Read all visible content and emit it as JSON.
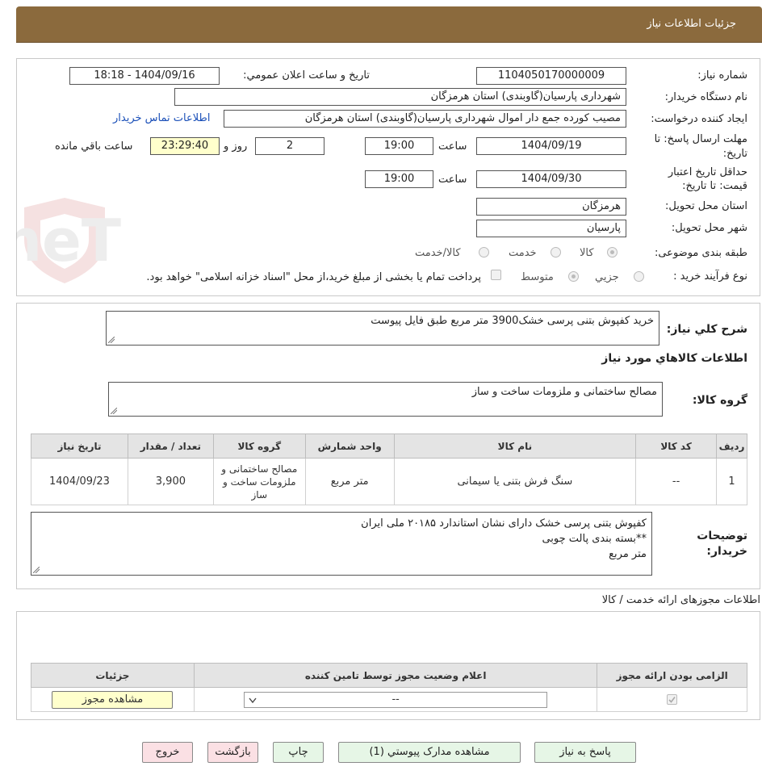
{
  "header": {
    "title": "جزئیات اطلاعات نیاز"
  },
  "form": {
    "need_number_label": "شماره نیاز:",
    "need_number": "1104050170000009",
    "announce_label": "تاریخ و ساعت اعلان عمومي:",
    "announce_value": "1404/09/16 - 18:18",
    "buyer_org_label": "نام دستگاه خریدار:",
    "buyer_org": "شهرداری پارسیان(گاوبندی) استان هرمزگان",
    "requester_label": "ایجاد کننده درخواست:",
    "requester": "مصیب کورده جمع دار اموال شهرداری پارسیان(گاوبندی) استان هرمزگان",
    "contact_link": "اطلاعات تماس خریدار",
    "deadline_label_1": "مهلت ارسال پاسخ: تا",
    "deadline_label_2": "تاریخ:",
    "deadline_date": "1404/09/19",
    "time_label": "ساعت",
    "deadline_time": "19:00",
    "days_value": "2",
    "days_label": "روز و",
    "remaining_time": "23:29:40",
    "remaining_label": "ساعت باقي مانده",
    "validity_label_1": "حداقل تاریخ اعتبار",
    "validity_label_2": "قیمت: تا تاریخ:",
    "validity_date": "1404/09/30",
    "validity_time": "19:00",
    "province_label": "استان محل تحویل:",
    "province": "هرمزگان",
    "city_label": "شهر محل تحویل:",
    "city": "پارسیان",
    "category_label": "طبقه بندی موضوعی:",
    "category_options": [
      "کالا",
      "خدمت",
      "کالا/خدمت"
    ],
    "process_label": "نوع فرآیند خرید :",
    "process_options": [
      "جزیي",
      "متوسط"
    ],
    "payment_note": "پرداخت تمام یا بخشی از مبلغ خرید،از محل \"اسناد خزانه اسلامی\" خواهد بود."
  },
  "summary": {
    "label": "شرح کلي نیاز:",
    "value": "خرید کفپوش بتنی پرسی خشک3900 متر مربع طبق فایل پیوست",
    "goods_info_title": "اطلاعات کالاهاي مورد نیاز",
    "group_label": "گروه کالا:",
    "group_value": "مصالح ساختمانی و ملزومات ساخت و ساز"
  },
  "goods_table": {
    "headers": [
      "ردیف",
      "کد کالا",
      "نام کالا",
      "واحد شمارش",
      "گروه کالا",
      "تعداد / مقدار",
      "تاریخ نیاز"
    ],
    "rows": [
      {
        "row": "1",
        "code": "--",
        "name": "سنگ فرش بتنی یا سیمانی",
        "unit": "متر مربع",
        "group": "مصالح ساختمانی و ملزومات ساخت و ساز",
        "qty": "3,900",
        "date": "1404/09/23"
      }
    ]
  },
  "buyer_notes": {
    "label_1": "توضیحات",
    "label_2": "خریدار:",
    "line1": "کفپوش بتنی پرسی خشک  دارای نشان استاندارد ۲۰۱۸۵ ملی ایران",
    "line2": "**بسته بندی پالت چوبی",
    "line3": "متر مربع"
  },
  "permits": {
    "title": "اطلاعات مجوزهای ارائه خدمت / کالا",
    "headers": [
      "الزامی بودن ارائه مجوز",
      "اعلام وضعیت مجوز توسط تامین کننده",
      "جزئیات"
    ],
    "select_value": "--",
    "view_button": "مشاهده مجوز"
  },
  "buttons": {
    "reply": "پاسخ به نیاز",
    "attachments": "مشاهده مدارک پیوستي (1)",
    "print": "چاپ",
    "back": "بازگشت",
    "exit": "خروج"
  },
  "watermark": {
    "text": "AriaTender.neT"
  },
  "colors": {
    "header": "#8b6a3d",
    "link": "#1a4fb8",
    "yellow": "#ffffcc",
    "green_btn": "#e6f6e6",
    "pink_btn": "#fbe0e4"
  }
}
